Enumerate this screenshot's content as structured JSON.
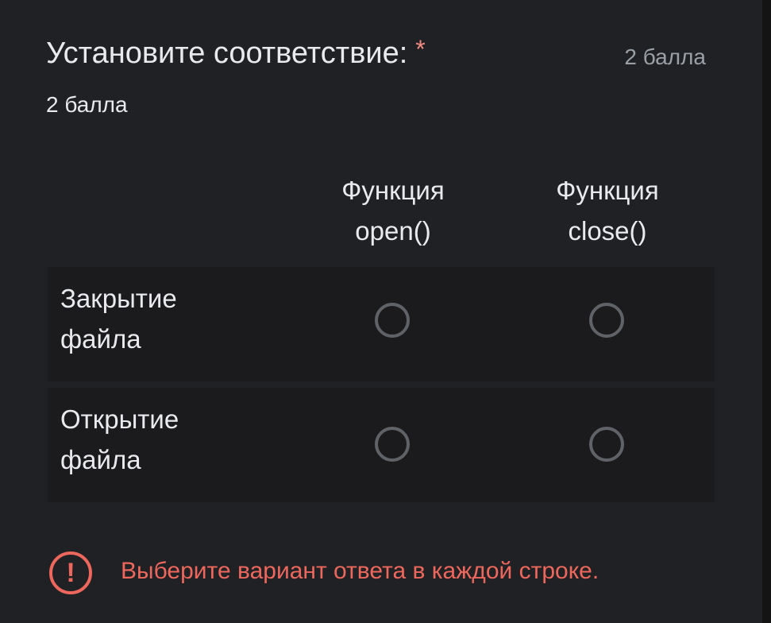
{
  "question": {
    "title": "Установите соответствие:",
    "required_mark": "*",
    "points_header": "2 балла",
    "points_line": "2 балла"
  },
  "grid": {
    "columns": [
      {
        "line1": "Функция",
        "line2": "open()"
      },
      {
        "line1": "Функция",
        "line2": "close()"
      }
    ],
    "rows": [
      {
        "line1": "Закрытие",
        "line2": "файла"
      },
      {
        "line1": "Открытие",
        "line2": "файла"
      }
    ]
  },
  "error": {
    "icon_glyph": "!",
    "message": "Выберите вариант ответа в каждой строке."
  },
  "colors": {
    "background": "#202124",
    "text": "#e8eaed",
    "secondary_text": "#9aa0a6",
    "error": "#ee675c",
    "required": "#f28b82",
    "radio_border": "#5f6368"
  }
}
